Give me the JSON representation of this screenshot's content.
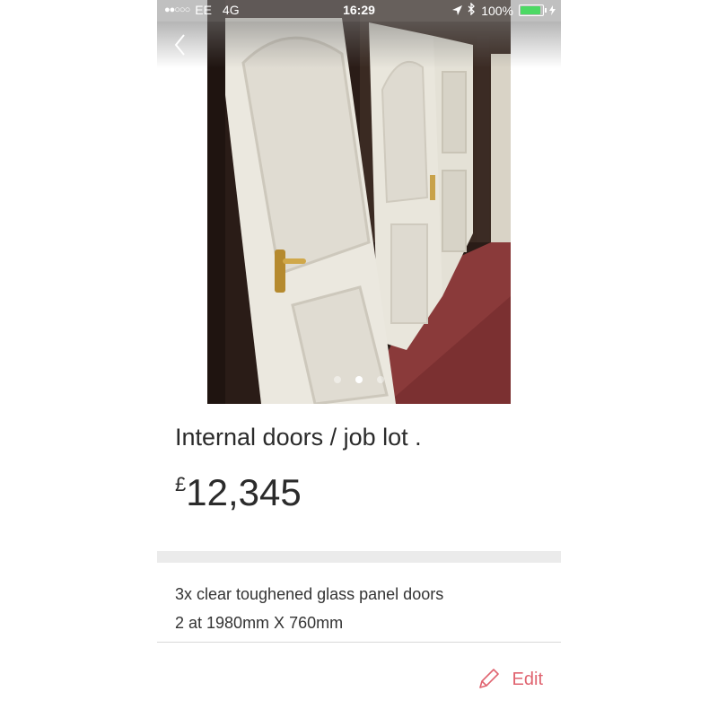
{
  "status_bar": {
    "signal": "●●○○○",
    "carrier": "EE",
    "network": "4G",
    "time": "16:29",
    "battery_percent": "100%",
    "battery_level": 1.0
  },
  "listing": {
    "title": "Internal doors / job lot .",
    "currency_symbol": "£",
    "price": "12,345",
    "description_lines": [
      "3x clear toughened glass panel doors",
      "2 at 1980mm X 760mm"
    ]
  },
  "gallery": {
    "total_images": 3,
    "active_index": 1
  },
  "actions": {
    "edit_label": "Edit"
  },
  "icons": {
    "back": "chevron-left-icon",
    "edit": "pencil-icon",
    "location": "location-arrow-icon",
    "bluetooth": "bluetooth-icon",
    "battery": "battery-icon"
  },
  "colors": {
    "accent": "#e06470",
    "battery_fill": "#4cd964",
    "text": "#2b2b2b",
    "floor": "#8a3a3a"
  }
}
